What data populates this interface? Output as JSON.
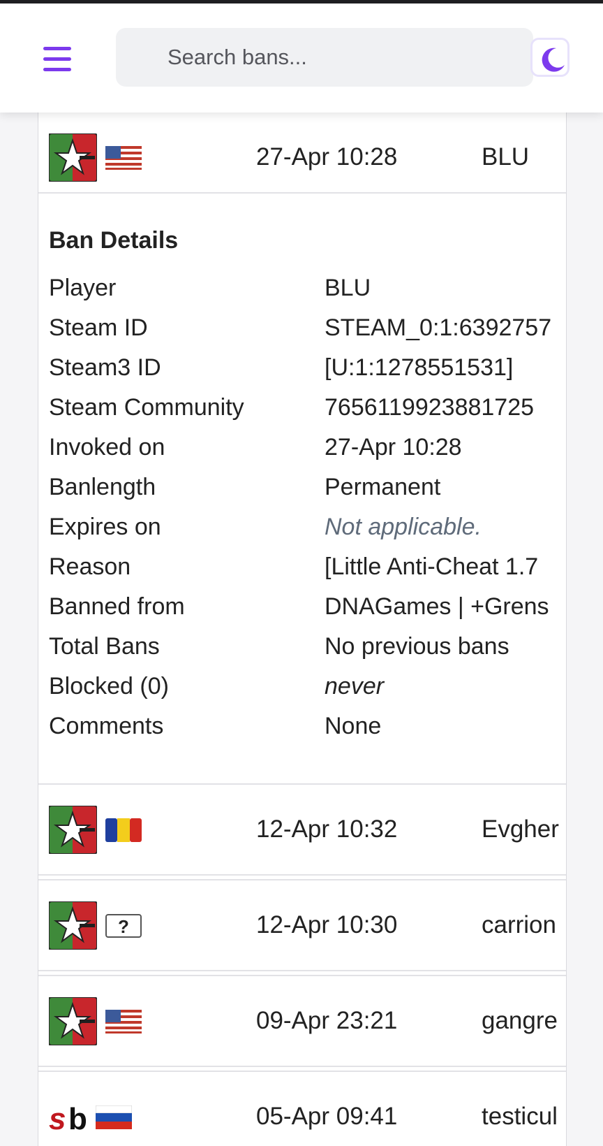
{
  "header": {
    "search_placeholder": "Search bans...",
    "menu_icon": "hamburger-menu-icon",
    "theme_icon": "moon-icon",
    "accent_color": "#7c3aed"
  },
  "expanded_ban": {
    "game_icon": "game-logo-star-icon",
    "flag": "us",
    "date": "27-Apr 10:28",
    "name": "BLU"
  },
  "details": {
    "title": "Ban Details",
    "rows": [
      {
        "label": "Player",
        "value": "BLU"
      },
      {
        "label": "Steam ID",
        "value": "STEAM_0:1:6392757"
      },
      {
        "label": "Steam3 ID",
        "value": "[U:1:1278551531]"
      },
      {
        "label": "Steam Community",
        "value": "7656119923881725"
      },
      {
        "label": "Invoked on",
        "value": "27-Apr 10:28"
      },
      {
        "label": "Banlength",
        "value": "Permanent"
      },
      {
        "label": "Expires on",
        "value": "Not applicable."
      },
      {
        "label": "Reason",
        "value": "[Little Anti-Cheat 1.7"
      },
      {
        "label": "Banned from",
        "value": "DNAGames | +Grens"
      },
      {
        "label": "Total Bans",
        "value": "No previous bans"
      },
      {
        "label": "Blocked (0)",
        "value": "never"
      },
      {
        "label": "Comments",
        "value": "None"
      }
    ]
  },
  "bans": [
    {
      "game_icon": "game-logo-star-icon",
      "flag": "ro",
      "date": "12-Apr 10:32",
      "name": "Evgher"
    },
    {
      "game_icon": "game-logo-star-icon",
      "flag": "unknown",
      "date": "12-Apr 10:30",
      "name": "carrion"
    },
    {
      "game_icon": "game-logo-star-icon",
      "flag": "us",
      "date": "09-Apr 23:21",
      "name": "gangre"
    },
    {
      "game_icon": "sourcebans-logo-icon",
      "flag": "ru",
      "date": "05-Apr 09:41",
      "name": "testicul"
    }
  ]
}
